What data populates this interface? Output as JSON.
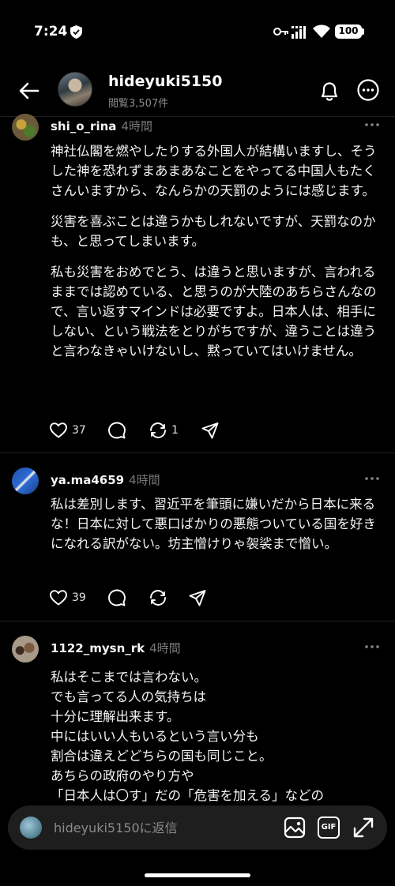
{
  "status_bar": {
    "time": "7:24",
    "battery": "100"
  },
  "header": {
    "username": "hideyuki5150",
    "views": "閲覧3,507件"
  },
  "comments": [
    {
      "user": "shi_o_rina",
      "time": "4時間",
      "paragraphs": [
        "神社仏閣を燃やしたりする外国人が結構いますし、そうした神を恐れずまあまあなことをやってる中国人もたくさんいますから、なんらかの天罰のようには感じます。",
        "災害を喜ぶことは違うかもしれないですが、天罰なのかも、と思ってしまいます。",
        "私も災害をおめでとう、は違うと思いますが、言われるままでは認めている、と思うのが大陸のあちらさんなので、言い返すマインドは必要ですよ。日本人は、相手にしない、という戦法をとりがちですが、違うことは違うと言わなきゃいけないし、黙っていてはいけません。"
      ],
      "likes": "37",
      "reposts": "1"
    },
    {
      "user": "ya.ma4659",
      "time": "4時間",
      "paragraphs": [
        "私は差別します、習近平を筆頭に嫌いだから日本に来るな！日本に対して悪口ばかりの悪態ついている国を好きになれる訳がない。坊主憎けりゃ袈裟まで憎い。"
      ],
      "likes": "39",
      "reposts": ""
    },
    {
      "user": "1122_mysn_rk",
      "time": "4時間",
      "lines": [
        "私はそこまでは言わない。",
        "でも言ってる人の気持ちは",
        "十分に理解出来ます。",
        "中にはいい人もいるという言い分も",
        "割合は違えどどちらの国も同じこと。",
        "あちらの政府のやり方や",
        "「日本人は〇す」だの「危害を加える」などの"
      ]
    }
  ],
  "reply": {
    "placeholder": "hideyuki5150に返信",
    "gif_label": "GIF"
  },
  "icons": [
    "shield-icon",
    "key-icon",
    "signal-icon",
    "wifi-icon",
    "back-arrow-icon",
    "bell-icon",
    "more-icon",
    "heart-icon",
    "comment-icon",
    "repost-icon",
    "share-icon",
    "image-icon",
    "expand-icon"
  ]
}
